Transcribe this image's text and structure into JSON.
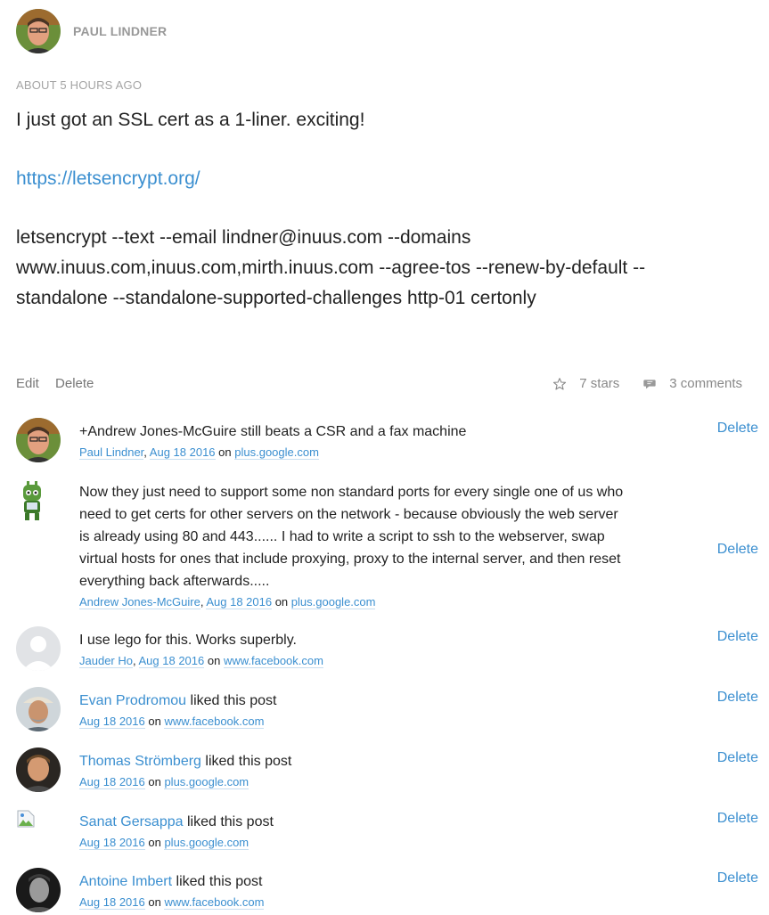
{
  "post": {
    "author": "PAUL LINDNER",
    "time": "ABOUT 5 HOURS AGO",
    "text": "I just got an SSL cert as a 1-liner. exciting!",
    "link": "https://letsencrypt.org/",
    "command": "letsencrypt --text --email lindner@inuus.com --domains www.inuus.com,inuus.com,mirth.inuus.com --agree-tos --renew-by-default --standalone --standalone-supported-challenges http-01 certonly"
  },
  "actions": {
    "edit": "Edit",
    "delete": "Delete",
    "stars": "7 stars",
    "comments": "3 comments"
  },
  "responses": [
    {
      "text": "+Andrew Jones-McGuire still beats a CSR and a fax machine",
      "author": "Paul Lindner",
      "date": "Aug 18 2016",
      "on": "on",
      "source": "plus.google.com",
      "delete": "Delete"
    },
    {
      "text": "Now they just need to support some non standard ports for every single one of us who need to get certs for other servers on the network - because obviously the web server is already using 80 and 443...... I had to write a script to ssh to the webserver, swap virtual hosts for ones that include proxying, proxy to the internal server, and then reset everything back afterwards.....",
      "author": "Andrew Jones-McGuire",
      "date": "Aug 18 2016",
      "on": "on",
      "source": "plus.google.com",
      "delete": "Delete"
    },
    {
      "text": "I use lego for this. Works superbly.",
      "author": "Jauder Ho",
      "date": "Aug 18 2016",
      "on": "on",
      "source": "www.facebook.com",
      "delete": "Delete"
    },
    {
      "name": "Evan Prodromou",
      "liked": "liked this post",
      "date": "Aug 18 2016",
      "on": "on",
      "source": "www.facebook.com",
      "delete": "Delete"
    },
    {
      "name": "Thomas Strömberg",
      "liked": "liked this post",
      "date": "Aug 18 2016",
      "on": "on",
      "source": "plus.google.com",
      "delete": "Delete"
    },
    {
      "name": "Sanat Gersappa",
      "liked": "liked this post",
      "date": "Aug 18 2016",
      "on": "on",
      "source": "plus.google.com",
      "delete": "Delete"
    },
    {
      "name": "Antoine Imbert",
      "liked": "liked this post",
      "date": "Aug 18 2016",
      "on": "on",
      "source": "www.facebook.com",
      "delete": "Delete"
    }
  ],
  "colors": {
    "link": "#3b8fd0",
    "muted": "#999999"
  },
  "icons": {
    "stars": "star-outline-icon",
    "comments": "speech-bubble-icon"
  }
}
